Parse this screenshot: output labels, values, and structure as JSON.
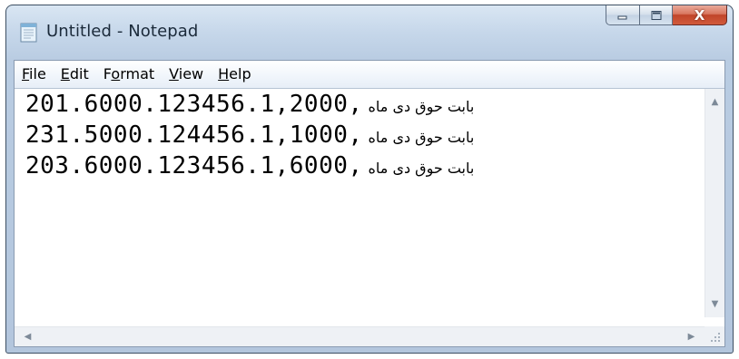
{
  "window": {
    "title": "Untitled - Notepad",
    "close_glyph": "X"
  },
  "menu": {
    "file": {
      "accel": "F",
      "rest": "ile"
    },
    "edit": {
      "accel": "E",
      "rest": "dit"
    },
    "format": {
      "pre": "F",
      "accel": "o",
      "rest": "rmat"
    },
    "view": {
      "accel": "V",
      "rest": "iew"
    },
    "help": {
      "accel": "H",
      "rest": "elp"
    }
  },
  "editor": {
    "lines": [
      {
        "code": "201.6000.123456.1,2000,",
        "persian": "بابت حوق دی ماه"
      },
      {
        "code": "231.5000.124456.1,1000,",
        "persian": "بابت حوق دی ماه"
      },
      {
        "code": "203.6000.123456.1,6000,",
        "persian": "بابت حوق دی ماه"
      }
    ]
  },
  "icons": {
    "app": "notepad-icon",
    "minimize": "minimize-icon",
    "maximize": "maximize-icon",
    "close": "close-icon",
    "scroll_up": "scroll-up-arrow-icon",
    "scroll_down": "scroll-down-arrow-icon",
    "scroll_left": "scroll-left-arrow-icon",
    "scroll_right": "scroll-right-arrow-icon",
    "size_grip": "size-grip-icon"
  },
  "colors": {
    "close_button": "#c9492b",
    "frame": "#c6d7ea"
  }
}
